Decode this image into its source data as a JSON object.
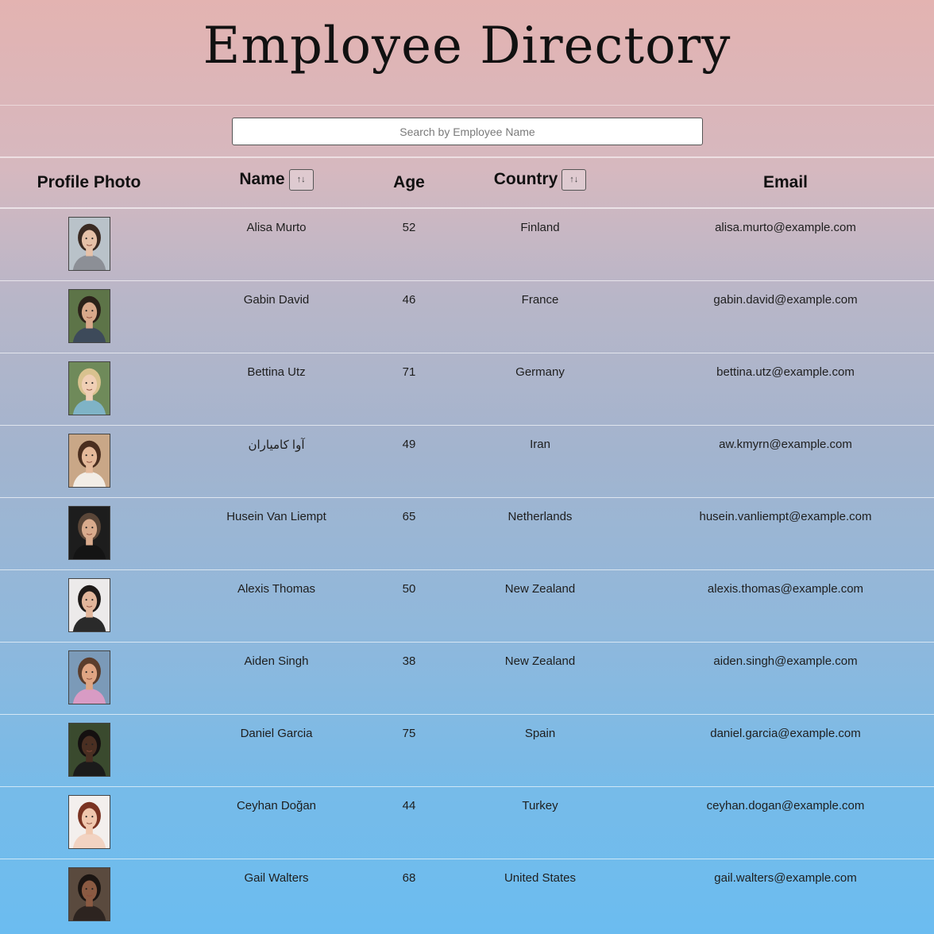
{
  "title": "Employee Directory",
  "search": {
    "placeholder": "Search by Employee Name",
    "value": ""
  },
  "columns": {
    "photo": "Profile Photo",
    "name": "Name",
    "age": "Age",
    "country": "Country",
    "email": "Email",
    "sort_glyph": "↑↓"
  },
  "employees": [
    {
      "name": "Alisa Murto",
      "age": "52",
      "country": "Finland",
      "email": "alisa.murto@example.com",
      "avatar": {
        "bg": "#b9c2c9",
        "skin": "#e6c1a8",
        "hair": "#3a2a22",
        "shirt": "#8c8f96"
      }
    },
    {
      "name": "Gabin David",
      "age": "46",
      "country": "France",
      "email": "gabin.david@example.com",
      "avatar": {
        "bg": "#5d7448",
        "skin": "#d8a88a",
        "hair": "#2b2119",
        "shirt": "#3d4a5a"
      }
    },
    {
      "name": "Bettina Utz",
      "age": "71",
      "country": "Germany",
      "email": "bettina.utz@example.com",
      "avatar": {
        "bg": "#6f8a5a",
        "skin": "#f0cfb5",
        "hair": "#d9c28f",
        "shirt": "#7fb3c6"
      }
    },
    {
      "name": "آوا کامیاران",
      "age": "49",
      "country": "Iran",
      "email": "aw.kmyrn@example.com",
      "avatar": {
        "bg": "#c9a787",
        "skin": "#e4b99a",
        "hair": "#4a2e1f",
        "shirt": "#f2ede6"
      }
    },
    {
      "name": "Husein Van Liempt",
      "age": "65",
      "country": "Netherlands",
      "email": "husein.vanliempt@example.com",
      "avatar": {
        "bg": "#1d1d1d",
        "skin": "#d9ab8d",
        "hair": "#5a4638",
        "shirt": "#141414"
      }
    },
    {
      "name": "Alexis Thomas",
      "age": "50",
      "country": "New Zealand",
      "email": "alexis.thomas@example.com",
      "avatar": {
        "bg": "#eceaea",
        "skin": "#e2b69b",
        "hair": "#1e1a18",
        "shirt": "#2a2a2a"
      }
    },
    {
      "name": "Aiden Singh",
      "age": "38",
      "country": "New Zealand",
      "email": "aiden.singh@example.com",
      "avatar": {
        "bg": "#7b9ab8",
        "skin": "#e0a583",
        "hair": "#5b3d2c",
        "shirt": "#d89bc4"
      }
    },
    {
      "name": "Daniel Garcia",
      "age": "75",
      "country": "Spain",
      "email": "daniel.garcia@example.com",
      "avatar": {
        "bg": "#3a4a2e",
        "skin": "#4a2f22",
        "hair": "#141010",
        "shirt": "#1b1b1b"
      }
    },
    {
      "name": "Ceyhan Doğan",
      "age": "44",
      "country": "Turkey",
      "email": "ceyhan.dogan@example.com",
      "avatar": {
        "bg": "#f3efed",
        "skin": "#f0c7ae",
        "hair": "#7a3322",
        "shirt": "#f2d3c2"
      }
    },
    {
      "name": "Gail Walters",
      "age": "68",
      "country": "United States",
      "email": "gail.walters@example.com",
      "avatar": {
        "bg": "#5a4a3e",
        "skin": "#8a5a42",
        "hair": "#1b1512",
        "shirt": "#2d2420"
      }
    }
  ]
}
